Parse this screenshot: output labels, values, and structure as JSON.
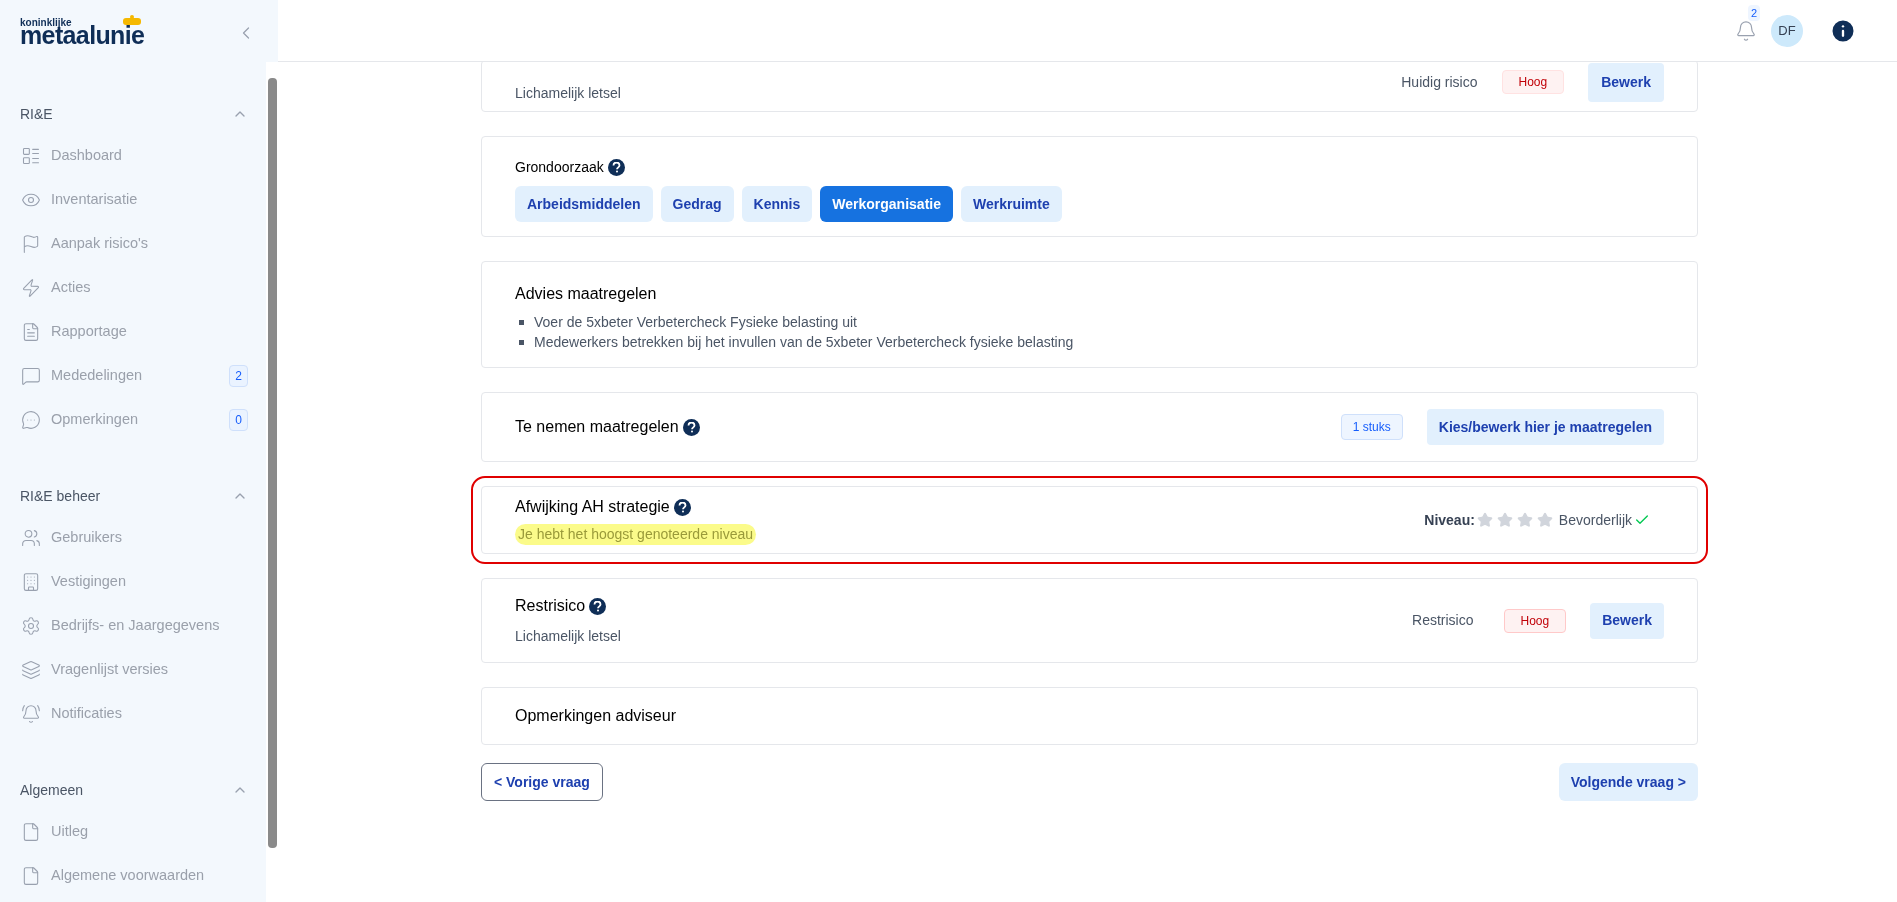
{
  "logo": {
    "small": "koninklijke",
    "large": "metaalunie"
  },
  "sidebar": {
    "sections": [
      {
        "title": "RI&E",
        "expanded": true,
        "items": [
          {
            "label": "Dashboard"
          },
          {
            "label": "Inventarisatie"
          },
          {
            "label": "Aanpak risico's"
          },
          {
            "label": "Acties"
          },
          {
            "label": "Rapportage"
          },
          {
            "label": "Mededelingen",
            "count": "2"
          },
          {
            "label": "Opmerkingen",
            "count": "0"
          }
        ]
      },
      {
        "title": "RI&E beheer",
        "expanded": true,
        "items": [
          {
            "label": "Gebruikers"
          },
          {
            "label": "Vestigingen"
          },
          {
            "label": "Bedrijfs- en Jaargegevens"
          },
          {
            "label": "Vragenlijst versies"
          },
          {
            "label": "Notificaties"
          }
        ]
      },
      {
        "title": "Algemeen",
        "expanded": true,
        "items": [
          {
            "label": "Uitleg"
          },
          {
            "label": "Algemene voorwaarden"
          }
        ]
      }
    ]
  },
  "header": {
    "notification_count": "2",
    "avatar_initials": "DF"
  },
  "current_risk": {
    "subtitle": "Lichamelijk letsel",
    "label": "Huidig risico",
    "badge": "Hoog",
    "button": "Bewerk"
  },
  "root_cause": {
    "title": "Grondoorzaak",
    "options": [
      {
        "label": "Arbeidsmiddelen",
        "selected": false
      },
      {
        "label": "Gedrag",
        "selected": false
      },
      {
        "label": "Kennis",
        "selected": false
      },
      {
        "label": "Werkorganisatie",
        "selected": true
      },
      {
        "label": "Werkruimte",
        "selected": false
      }
    ]
  },
  "advice": {
    "title": "Advies maatregelen",
    "items": [
      "Voer de 5xbeter Verbetercheck Fysieke belasting uit",
      "Medewerkers betrekken bij het invullen van de 5xbeter Verbetercheck fysieke belasting"
    ]
  },
  "measures": {
    "title": "Te nemen maatregelen",
    "count": "1 stuks",
    "button": "Kies/bewerk hier je maatregelen"
  },
  "deviation": {
    "title": "Afwijking AH strategie",
    "note": "Je hebt het hoogst genoteerde niveau",
    "level_label": "Niveau:",
    "stars": 0,
    "level_name": "Bevorderlijk",
    "achieved": true
  },
  "residual_risk": {
    "title": "Restrisico",
    "subtitle": "Lichamelijk letsel",
    "label": "Restrisico",
    "badge": "Hoog",
    "button": "Bewerk"
  },
  "advisor_remarks": {
    "title": "Opmerkingen adviseur"
  },
  "navigation": {
    "previous": "< Vorige vraag",
    "next": "Volgende vraag >"
  }
}
